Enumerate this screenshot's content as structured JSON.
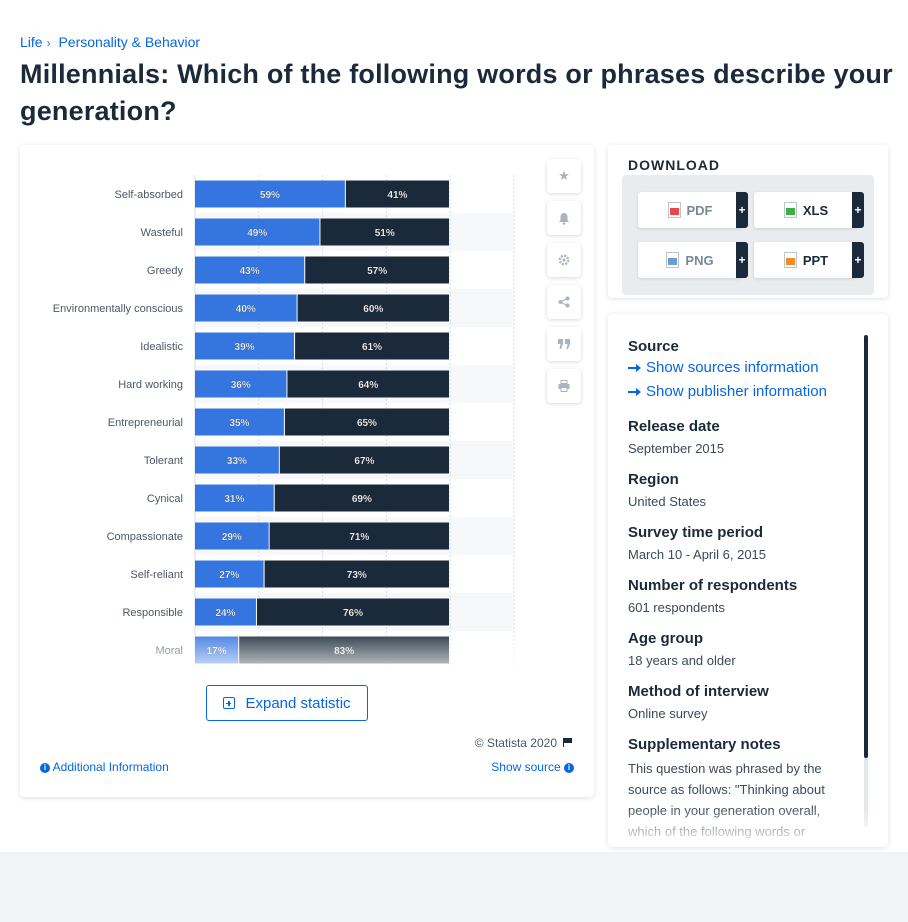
{
  "breadcrumb": {
    "items": [
      "Life",
      "Personality & Behavior"
    ],
    "separator": "›"
  },
  "title": "Millennials: Which of the following words or phrases describe your generation?",
  "chart_data": {
    "type": "bar",
    "stacked": true,
    "orientation": "horizontal",
    "categories": [
      "Self-absorbed",
      "Wasteful",
      "Greedy",
      "Environmentally conscious",
      "Idealistic",
      "Hard working",
      "Entrepreneurial",
      "Tolerant",
      "Cynical",
      "Compassionate",
      "Self-reliant",
      "Responsible",
      "Moral"
    ],
    "series": [
      {
        "values": [
          59,
          49,
          43,
          40,
          39,
          36,
          35,
          33,
          31,
          29,
          27,
          24,
          17
        ],
        "color": "#3475e0"
      },
      {
        "values": [
          41,
          51,
          57,
          60,
          61,
          64,
          65,
          67,
          69,
          71,
          73,
          76,
          83
        ],
        "color": "#1b2a3a"
      }
    ],
    "value_format": "{v}%",
    "xlim": [
      0,
      100
    ],
    "grid": true
  },
  "toolbar": {
    "icons": [
      "star-icon",
      "bell-icon",
      "gear-icon",
      "share-icon",
      "quote-icon",
      "print-icon"
    ]
  },
  "expand_label": "Expand statistic",
  "copyright": "© Statista 2020",
  "additional_info": "Additional Information",
  "show_source": "Show source",
  "download": {
    "title": "DOWNLOAD",
    "buttons": [
      {
        "label": "PDF",
        "color": "#e5484d"
      },
      {
        "label": "XLS",
        "color": "#3fae49"
      },
      {
        "label": "PNG",
        "color": "#6a9bd1"
      },
      {
        "label": "PPT",
        "color": "#f28c28"
      }
    ],
    "plus": "+"
  },
  "source": {
    "heading": "Source",
    "links": [
      "Show sources information",
      "Show publisher information"
    ],
    "fields": [
      {
        "label": "Release date",
        "value": "September 2015"
      },
      {
        "label": "Region",
        "value": "United States"
      },
      {
        "label": "Survey time period",
        "value": "March 10 - April 6, 2015"
      },
      {
        "label": "Number of respondents",
        "value": "601 respondents"
      },
      {
        "label": "Age group",
        "value": "18 years and older"
      },
      {
        "label": "Method of interview",
        "value": "Online survey"
      },
      {
        "label": "Supplementary notes",
        "value": "This question was phrased by the source as follows: \"Thinking about people in your generation overall, which of the following words or phrases describe your generation?\""
      }
    ]
  }
}
